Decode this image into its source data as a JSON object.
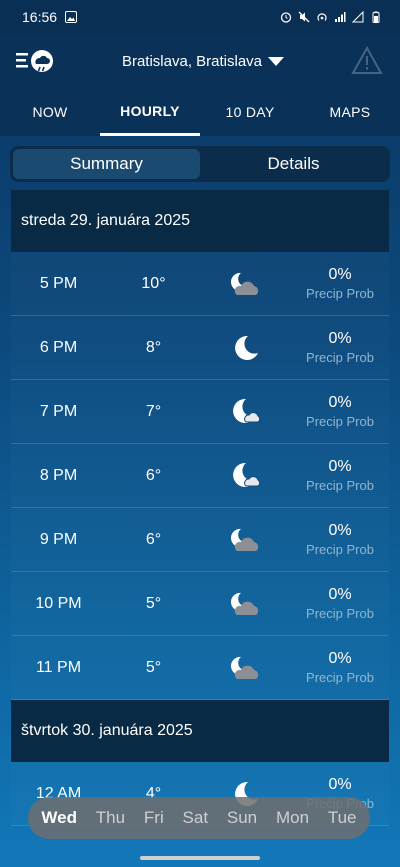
{
  "status": {
    "time": "16:56"
  },
  "header": {
    "location": "Bratislava, Bratislava"
  },
  "tabs": [
    {
      "label": "NOW"
    },
    {
      "label": "HOURLY"
    },
    {
      "label": "10 DAY"
    },
    {
      "label": "MAPS"
    }
  ],
  "segment": {
    "summary": "Summary",
    "details": "Details"
  },
  "days": [
    {
      "title": "streda 29. januára 2025",
      "rows": [
        {
          "time": "5 PM",
          "temp": "10°",
          "icon": "moon-cloud-icon",
          "precip": "0%",
          "precip_label": "Precip Prob"
        },
        {
          "time": "6 PM",
          "temp": "8°",
          "icon": "moon-icon",
          "precip": "0%",
          "precip_label": "Precip Prob"
        },
        {
          "time": "7 PM",
          "temp": "7°",
          "icon": "moon-small-cloud-icon",
          "precip": "0%",
          "precip_label": "Precip Prob"
        },
        {
          "time": "8 PM",
          "temp": "6°",
          "icon": "moon-small-cloud-icon",
          "precip": "0%",
          "precip_label": "Precip Prob"
        },
        {
          "time": "9 PM",
          "temp": "6°",
          "icon": "moon-cloud-icon",
          "precip": "0%",
          "precip_label": "Precip Prob"
        },
        {
          "time": "10 PM",
          "temp": "5°",
          "icon": "moon-cloud-icon",
          "precip": "0%",
          "precip_label": "Precip Prob"
        },
        {
          "time": "11 PM",
          "temp": "5°",
          "icon": "moon-cloud-icon",
          "precip": "0%",
          "precip_label": "Precip Prob"
        }
      ]
    },
    {
      "title": "štvrtok 30. januára 2025",
      "rows": [
        {
          "time": "12 AM",
          "temp": "4°",
          "icon": "moon-icon",
          "precip": "0%",
          "precip_label": "Precip Prob"
        }
      ]
    }
  ],
  "day_nav": [
    "Wed",
    "Thu",
    "Fri",
    "Sat",
    "Sun",
    "Mon",
    "Tue"
  ]
}
